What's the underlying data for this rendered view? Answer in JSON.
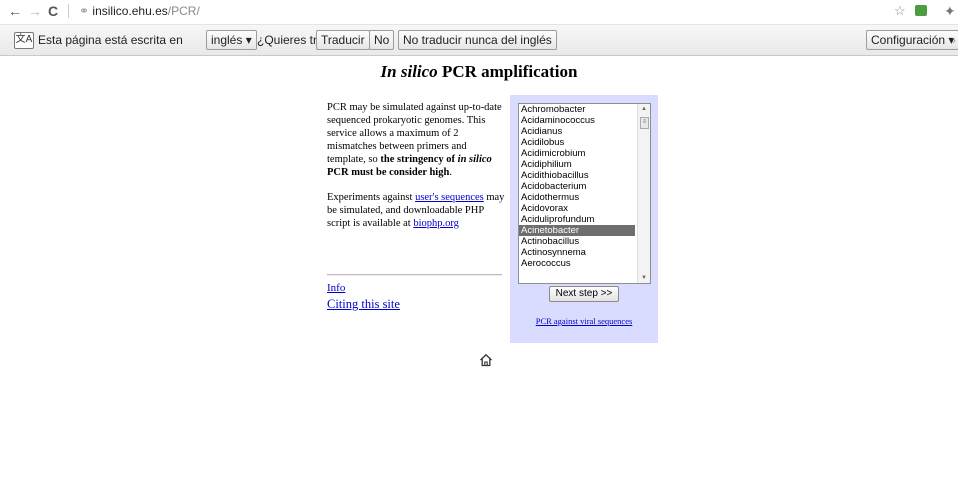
{
  "browser": {
    "url_host": "insilico.ehu.es",
    "url_path": "/PCR/"
  },
  "translate_bar": {
    "prefix": "Esta página está escrita en",
    "language": "inglés ▾",
    "question": "¿Quieres traducirla?",
    "translate_label": "Traducir",
    "no_label": "No",
    "never_label": "No traducir nunca del inglés",
    "settings_label": "Configuración ▾"
  },
  "page": {
    "title_italic": "In silico",
    "title_rest": " PCR amplification",
    "intro": {
      "t1": "PCR may be simulated against up-to-date sequenced prokaryotic genomes. This service allows a maximum of 2 mismatches between primers and template, so ",
      "b1": "the stringency of ",
      "bi": "in silico",
      "b2": " PCR must be consider high",
      "t2": "."
    },
    "experiments": {
      "t1": "Experiments against ",
      "link1": "user's sequences",
      "t2": " may be simulated, and downloadable PHP script is available at ",
      "link2": "biophp.org"
    },
    "info_link": "Info",
    "cite_link": "Citing this site",
    "genus_list": [
      "Achromobacter",
      "Acidaminococcus",
      "Acidianus",
      "Acidilobus",
      "Acidimicrobium",
      "Acidiphilium",
      "Acidithiobacillus",
      "Acidobacterium",
      "Acidothermus",
      "Acidovorax",
      "Aciduliprofundum",
      "Acinetobacter",
      "Actinobacillus",
      "Actinosynnema",
      "Aerococcus"
    ],
    "selected_genus": "Acinetobacter",
    "next_button": "Next step >>",
    "viral_link": "PCR against viral sequences"
  },
  "colors": {
    "panel_bg": "#d9dcff",
    "link": "#0000cc",
    "selected_option": "#6e6e6e"
  }
}
